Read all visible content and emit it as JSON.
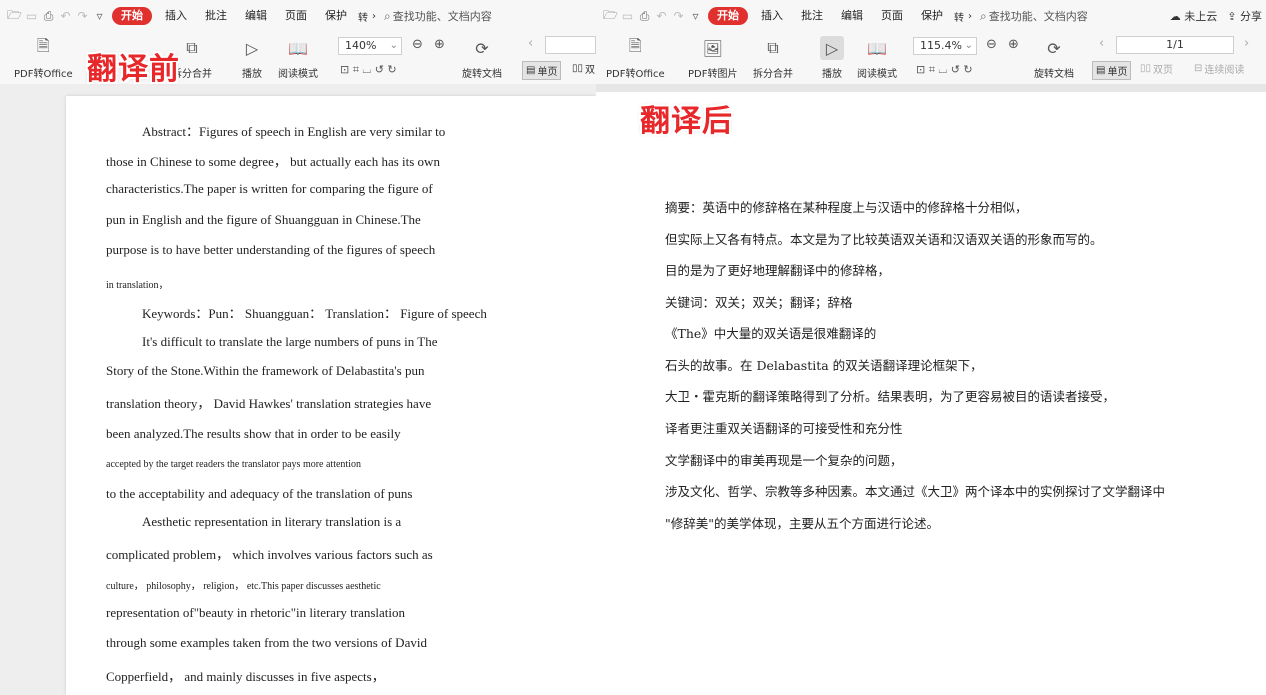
{
  "toolbar": {
    "menu": [
      "开始",
      "插入",
      "批注",
      "编辑",
      "页面",
      "保护"
    ],
    "menu_more": "转",
    "search_placeholder": "查找功能、文档内容",
    "cloud": "未上云",
    "share": "分享"
  },
  "left_ribbon": {
    "pdf_to_office": "PDF转Office",
    "split_merge": "拆分合并",
    "play": "播放",
    "read_mode": "阅读模式",
    "zoom": "140%",
    "rotate_doc": "旋转文档",
    "single_page": "单页",
    "double_page_partial": "双"
  },
  "right_ribbon": {
    "pdf_to_office": "PDF转Office",
    "pdf_to_image": "PDF转图片",
    "split_merge": "拆分合并",
    "play": "播放",
    "read_mode": "阅读模式",
    "zoom": "115.4%",
    "rotate_doc": "旋转文档",
    "page_indicator": "1/1",
    "single_page": "单页",
    "double_page": "双页",
    "continuous": "连续阅读"
  },
  "labels": {
    "before": "翻译前",
    "after": "翻译后"
  },
  "left_doc": {
    "lines": [
      {
        "text": "Abstract：Figures of speech in English are very similar to"
      },
      {
        "text": "those in Chinese to some degree， but actually each has its own"
      },
      {
        "text": "characteristics.The paper is written for comparing the figure of"
      },
      {
        "text": "pun in English and the figure of Shuangguan in Chinese.The"
      },
      {
        "text": "purpose is to have better understanding of the figures of speech"
      },
      {
        "text": "in translation，"
      },
      {
        "text": "Keywords：Pun： Shuangguan： Translation： Figure of speech"
      },
      {
        "text": "It's difficult to translate the large numbers of puns in The"
      },
      {
        "text": "Story of the Stone.Within the framework of Delabastita's pun"
      },
      {
        "text": "translation theory， David Hawkes' translation strategies have"
      },
      {
        "text": "been analyzed.The results show that in order to be easily"
      },
      {
        "text": "accepted by the target readers the translator pays more attention"
      },
      {
        "text": "to the acceptability and adequacy of the translation of puns"
      },
      {
        "text": "Aesthetic representation in literary translation is a"
      },
      {
        "text": "complicated problem， which involves various factors such as"
      },
      {
        "text": "culture， philosophy， religion， etc.This paper discusses aesthetic"
      },
      {
        "text": "representation of\"beauty in rhetoric\"in literary translation"
      },
      {
        "text": "through some examples taken from the two versions of David"
      },
      {
        "text": "Copperfield， and mainly discusses in five aspects，"
      }
    ]
  },
  "right_doc": {
    "lines": [
      {
        "text": "摘要：英语中的修辞格在某种程度上与汉语中的修辞格十分相似，"
      },
      {
        "text": "但实际上又各有特点。本文是为了比较英语双关语和汉语双关语的形象而写的。"
      },
      {
        "text": "目的是为了更好地理解翻译中的修辞格，"
      },
      {
        "text": "关键词：双关；双关；翻译；辞格"
      },
      {
        "text": "《The》中大量的双关语是很难翻译的"
      },
      {
        "text": "石头的故事。在 Delabastita 的双关语翻译理论框架下，"
      },
      {
        "text": "大卫・霍克斯的翻译策略得到了分析。结果表明，为了更容易被目的语读者接受，"
      },
      {
        "text": "译者更注重双关语翻译的可接受性和充分性"
      },
      {
        "text": "文学翻译中的审美再现是一个复杂的问题，"
      },
      {
        "text": "涉及文化、哲学、宗教等多种因素。本文通过《大卫》两个译本中的实例探讨了文学翻译中"
      },
      {
        "text": "\"修辞美\"的美学体现，主要从五个方面进行论述。"
      }
    ]
  }
}
